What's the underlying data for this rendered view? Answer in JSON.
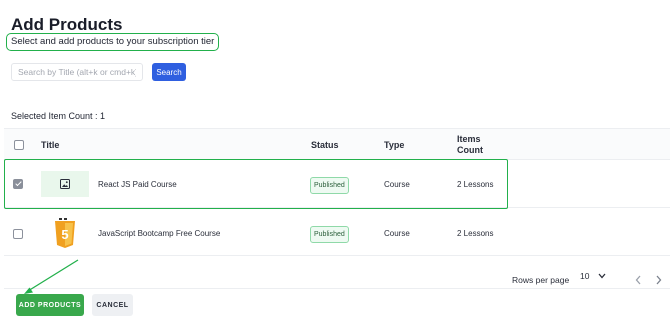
{
  "header": {
    "title": "Add Products",
    "subtitle": "Select and add products to your subscription tier"
  },
  "search": {
    "placeholder": "Search by Title (alt+k or cmd+k)",
    "value": "",
    "button_label": "Search"
  },
  "selection": {
    "count_text": "Selected Item Count : 1"
  },
  "table": {
    "columns": {
      "title": "Title",
      "status": "Status",
      "type": "Type",
      "items_count_line1": "Items",
      "items_count_line2": "Count"
    },
    "rows": [
      {
        "selected": true,
        "thumbnail": "image-placeholder-icon",
        "title": "React JS Paid Course",
        "status": "Published",
        "type": "Course",
        "items_count": "2 Lessons"
      },
      {
        "selected": false,
        "thumbnail": "js-logo-icon",
        "title": "JavaScript Bootcamp Free Course",
        "status": "Published",
        "type": "Course",
        "items_count": "2 Lessons"
      }
    ]
  },
  "pagination": {
    "rows_per_page_label": "Rows per page",
    "rows_per_page_value": "10"
  },
  "actions": {
    "add_label": "ADD PRODUCTS",
    "cancel_label": "CANCEL"
  },
  "colors": {
    "accent_blue": "#2f5fe0",
    "highlight_green": "#22b04b",
    "button_green": "#39a84c",
    "badge_bg": "#eefaf2"
  }
}
